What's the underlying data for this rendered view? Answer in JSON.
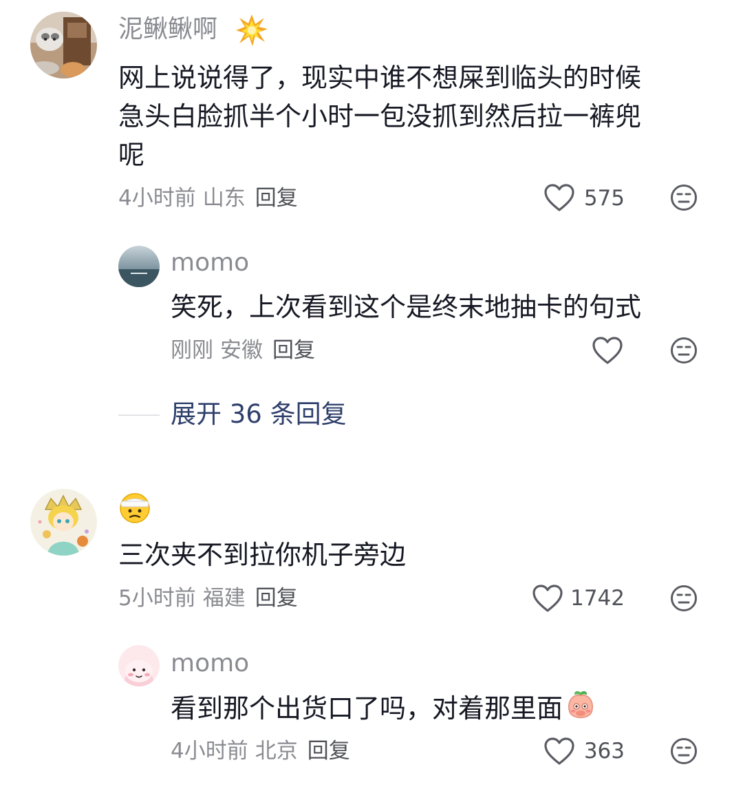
{
  "comments": [
    {
      "name": "泥鳅鳅啊",
      "text_lines": [
        "网上说说得了，现实中谁不想屎到临头的时候",
        "急头白脸抓半个小时一包没抓到然后拉一裤兜",
        "呢"
      ],
      "time": "4小时前",
      "location": "山东",
      "reply": "回复",
      "likes": "575",
      "replies": [
        {
          "name": "momo",
          "text": "笑死，上次看到这个是终末地抽卡的句式",
          "time": "刚刚",
          "location": "安徽",
          "reply": "回复"
        }
      ],
      "expand_label": "展开 36 条回复"
    },
    {
      "text": "三次夹不到拉你机子旁边",
      "time": "5小时前",
      "location": "福建",
      "reply": "回复",
      "likes": "1742",
      "replies": [
        {
          "name": "momo",
          "text": "看到那个出货口了吗，对着那里面",
          "time": "4小时前",
          "location": "北京",
          "reply": "回复",
          "likes": "363"
        }
      ]
    }
  ],
  "icons": {
    "like": "heart-outline-icon",
    "dislike": "meh-face-icon",
    "name_emoji": "explosion-emoji",
    "username_emoji": "bandaged-face-emoji",
    "inline_emoji": "peach-shy-emoji"
  },
  "colors": {
    "text": "#161823",
    "muted": "#8a8b91",
    "link": "#2e3f6b"
  }
}
